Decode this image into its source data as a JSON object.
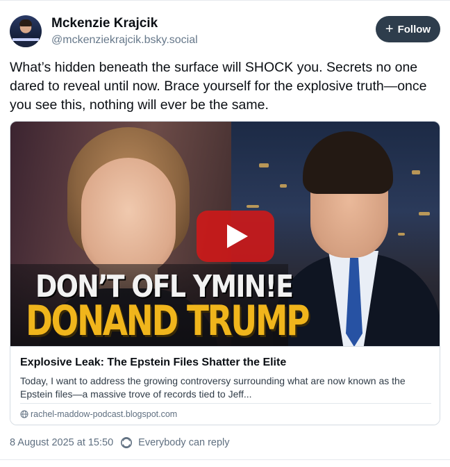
{
  "author": {
    "display_name": "Mckenzie Krajcik",
    "handle": "@mckenziekrajcik.bsky.social"
  },
  "follow_button": {
    "icon": "plus-icon",
    "label": "Follow"
  },
  "post": {
    "text": "What’s hidden beneath the surface will SHOCK you. Secrets no one dared to reveal until now. Brace yourself for the explosive truth—once you see this, nothing will ever be the same."
  },
  "embed": {
    "thumbnail": {
      "overlay_line1": "DON’T OFL YMIN!E",
      "overlay_line2": "DONAND TRUMP",
      "play_icon": "play-icon"
    },
    "title": "Explosive Leak: The Epstein Files Shatter the Elite",
    "description": "Today, I want to address the growing controversy surrounding what are now known as the Epstein files—a massive trove of records tied to Jeff...",
    "domain_icon": "globe-icon",
    "domain": "rachel-maddow-podcast.blogspot.com"
  },
  "meta": {
    "timestamp": "8 August 2025 at 15:50",
    "reply_icon": "reply-settings-icon",
    "reply_setting": "Everybody can reply"
  },
  "colors": {
    "follow_bg": "#2e3d4c",
    "play_red": "#d21818",
    "headline_yellow": "#f0b51c",
    "muted_text": "#5f6f80"
  }
}
